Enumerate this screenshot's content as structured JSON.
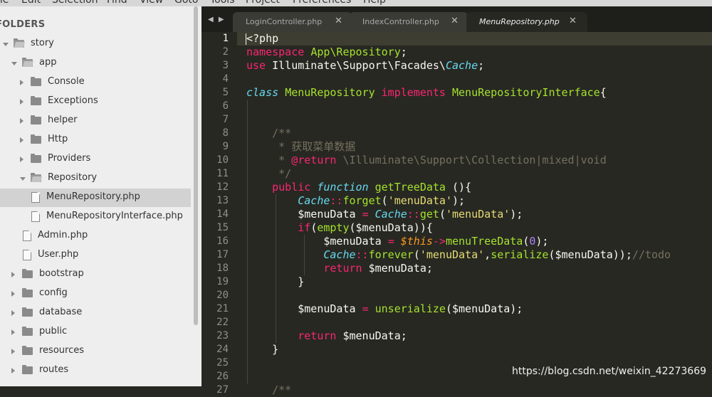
{
  "menu": [
    "ile",
    "Edit",
    "Selection",
    "Find",
    "View",
    "Goto",
    "Tools",
    "Project",
    "Preferences",
    "Help"
  ],
  "sidebar": {
    "title": "FOLDERS",
    "items": [
      {
        "label": "story",
        "type": "folder",
        "state": "open",
        "depth": 0
      },
      {
        "label": "app",
        "type": "folder",
        "state": "open",
        "depth": 1
      },
      {
        "label": "Console",
        "type": "folder",
        "state": "closed",
        "depth": 2
      },
      {
        "label": "Exceptions",
        "type": "folder",
        "state": "closed",
        "depth": 2
      },
      {
        "label": "helper",
        "type": "folder",
        "state": "closed",
        "depth": 2
      },
      {
        "label": "Http",
        "type": "folder",
        "state": "closed",
        "depth": 2
      },
      {
        "label": "Providers",
        "type": "folder",
        "state": "closed",
        "depth": 2
      },
      {
        "label": "Repository",
        "type": "folder",
        "state": "open",
        "depth": 2
      },
      {
        "label": "MenuRepository.php",
        "type": "file",
        "depth": 3,
        "selected": true
      },
      {
        "label": "MenuRepositoryInterface.php",
        "type": "file",
        "depth": 3
      },
      {
        "label": "Admin.php",
        "type": "file",
        "depth": 2
      },
      {
        "label": "User.php",
        "type": "file",
        "depth": 2
      },
      {
        "label": "bootstrap",
        "type": "folder",
        "state": "closed",
        "depth": 1
      },
      {
        "label": "config",
        "type": "folder",
        "state": "closed",
        "depth": 1
      },
      {
        "label": "database",
        "type": "folder",
        "state": "closed",
        "depth": 1
      },
      {
        "label": "public",
        "type": "folder",
        "state": "closed",
        "depth": 1
      },
      {
        "label": "resources",
        "type": "folder",
        "state": "closed",
        "depth": 1
      },
      {
        "label": "routes",
        "type": "folder",
        "state": "closed",
        "depth": 1
      }
    ]
  },
  "tabs": [
    {
      "label": "LoginController.php",
      "close": "✕",
      "active": false
    },
    {
      "label": "IndexController.php",
      "close": "✕",
      "active": false
    },
    {
      "label": "MenuRepository.php",
      "close": "✕",
      "active": true
    }
  ],
  "nav_arrows": "◀ ▶",
  "editor": {
    "current_line": 1,
    "line_numbers": [
      "1",
      "2",
      "3",
      "4",
      "5",
      "6",
      "7",
      "8",
      "9",
      "10",
      "11",
      "12",
      "13",
      "14",
      "15",
      "16",
      "17",
      "18",
      "19",
      "20",
      "21",
      "22",
      "23",
      "24",
      "25",
      "26",
      "27"
    ],
    "lines": [
      [
        [
          "plain",
          "<?php"
        ]
      ],
      [
        [
          "kw",
          "namespace"
        ],
        [
          "plain",
          " "
        ],
        [
          "fn",
          "App\\Repository"
        ],
        [
          "plain",
          ";"
        ]
      ],
      [
        [
          "kw",
          "use"
        ],
        [
          "plain",
          " Illuminate\\Support\\Facades\\"
        ],
        [
          "st",
          "Cache"
        ],
        [
          "plain",
          ";"
        ]
      ],
      [],
      [
        [
          "st",
          "class"
        ],
        [
          "plain",
          " "
        ],
        [
          "fn",
          "MenuRepository"
        ],
        [
          "plain",
          " "
        ],
        [
          "kw",
          "implements"
        ],
        [
          "plain",
          " "
        ],
        [
          "fn",
          "MenuRepositoryInterface"
        ],
        [
          "plain",
          "{"
        ]
      ],
      [],
      [],
      [
        [
          "plain",
          "    "
        ],
        [
          "cm",
          "/**"
        ]
      ],
      [
        [
          "plain",
          "    "
        ],
        [
          "cm",
          " * 获取菜单数据"
        ]
      ],
      [
        [
          "plain",
          "    "
        ],
        [
          "cm",
          " * "
        ],
        [
          "kw",
          "@return"
        ],
        [
          "cm",
          " \\Illuminate\\Support\\Collection|mixed|void"
        ]
      ],
      [
        [
          "plain",
          "    "
        ],
        [
          "cm",
          " */"
        ]
      ],
      [
        [
          "plain",
          "    "
        ],
        [
          "kw",
          "public"
        ],
        [
          "plain",
          " "
        ],
        [
          "st",
          "function"
        ],
        [
          "plain",
          " "
        ],
        [
          "fn",
          "getTreeData"
        ],
        [
          "plain",
          " (){"
        ]
      ],
      [
        [
          "plain",
          "        "
        ],
        [
          "st",
          "Cache"
        ],
        [
          "kw",
          "::"
        ],
        [
          "fn",
          "forget"
        ],
        [
          "plain",
          "("
        ],
        [
          "str",
          "'menuData'"
        ],
        [
          "plain",
          ");"
        ]
      ],
      [
        [
          "plain",
          "        $menuData "
        ],
        [
          "kw",
          "="
        ],
        [
          "plain",
          " "
        ],
        [
          "st",
          "Cache"
        ],
        [
          "kw",
          "::"
        ],
        [
          "fn",
          "get"
        ],
        [
          "plain",
          "("
        ],
        [
          "str",
          "'menuData'"
        ],
        [
          "plain",
          ");"
        ]
      ],
      [
        [
          "plain",
          "        "
        ],
        [
          "kw",
          "if"
        ],
        [
          "plain",
          "("
        ],
        [
          "fn",
          "empty"
        ],
        [
          "plain",
          "($menuData)){"
        ]
      ],
      [
        [
          "plain",
          "            $menuData "
        ],
        [
          "kw",
          "="
        ],
        [
          "plain",
          " "
        ],
        [
          "var",
          "$this"
        ],
        [
          "kw",
          "->"
        ],
        [
          "fn",
          "menuTreeData"
        ],
        [
          "plain",
          "("
        ],
        [
          "num",
          "0"
        ],
        [
          "plain",
          ");"
        ]
      ],
      [
        [
          "plain",
          "            "
        ],
        [
          "st",
          "Cache"
        ],
        [
          "kw",
          "::"
        ],
        [
          "fn",
          "forever"
        ],
        [
          "plain",
          "("
        ],
        [
          "str",
          "'menuData'"
        ],
        [
          "plain",
          ","
        ],
        [
          "fn",
          "serialize"
        ],
        [
          "plain",
          "($menuData));"
        ],
        [
          "cm",
          "//todo"
        ]
      ],
      [
        [
          "plain",
          "            "
        ],
        [
          "kw",
          "return"
        ],
        [
          "plain",
          " $menuData;"
        ]
      ],
      [
        [
          "plain",
          "        }"
        ]
      ],
      [],
      [
        [
          "plain",
          "        $menuData "
        ],
        [
          "kw",
          "="
        ],
        [
          "plain",
          " "
        ],
        [
          "fn",
          "unserialize"
        ],
        [
          "plain",
          "($menuData);"
        ]
      ],
      [],
      [
        [
          "plain",
          "        "
        ],
        [
          "kw",
          "return"
        ],
        [
          "plain",
          " $menuData;"
        ]
      ],
      [
        [
          "plain",
          "    }"
        ]
      ],
      [],
      [],
      [
        [
          "plain",
          "    "
        ],
        [
          "cm",
          "/**"
        ]
      ]
    ]
  },
  "watermark": "https://blog.csdn.net/weixin_42273669"
}
